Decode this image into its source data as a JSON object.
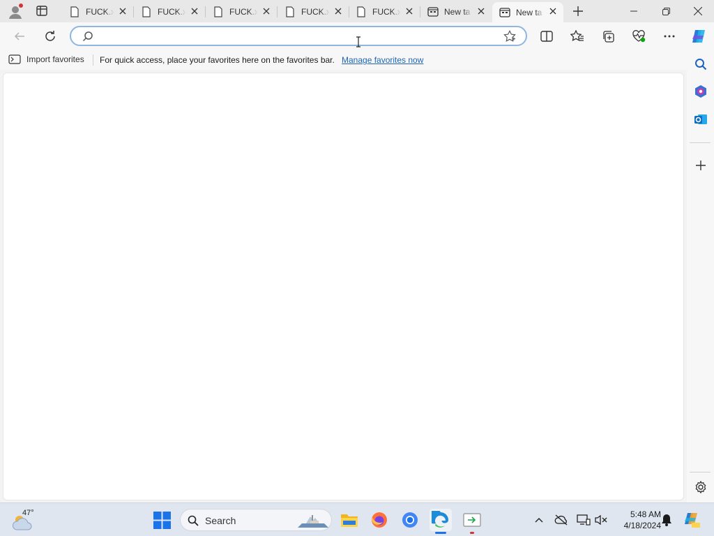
{
  "browser": {
    "tabs": [
      {
        "title": "FUCK.x",
        "icon": "document-icon",
        "active": false
      },
      {
        "title": "FUCK.x",
        "icon": "document-icon",
        "active": false
      },
      {
        "title": "FUCK.x",
        "icon": "document-icon",
        "active": false
      },
      {
        "title": "FUCK.x",
        "icon": "document-icon",
        "active": false
      },
      {
        "title": "FUCK.x",
        "icon": "document-icon",
        "active": false
      },
      {
        "title": "New ta",
        "icon": "newtab-icon",
        "active": false
      },
      {
        "title": "New ta",
        "icon": "newtab-icon",
        "active": true
      }
    ],
    "address": {
      "value": "",
      "placeholder": ""
    },
    "favorites_bar": {
      "import_label": "Import favorites",
      "message": "For quick access, place your favorites here on the favorites bar.",
      "manage_link": "Manage favorites now"
    }
  },
  "taskbar": {
    "weather_temp": "47°",
    "search_label": "Search",
    "time": "5:48 AM",
    "date": "4/18/2024"
  },
  "colors": {
    "accent": "#1f64b4",
    "address_border": "#8eb6e0",
    "copilot": "#2a7ad8",
    "outlook": "#0f6cbd"
  }
}
